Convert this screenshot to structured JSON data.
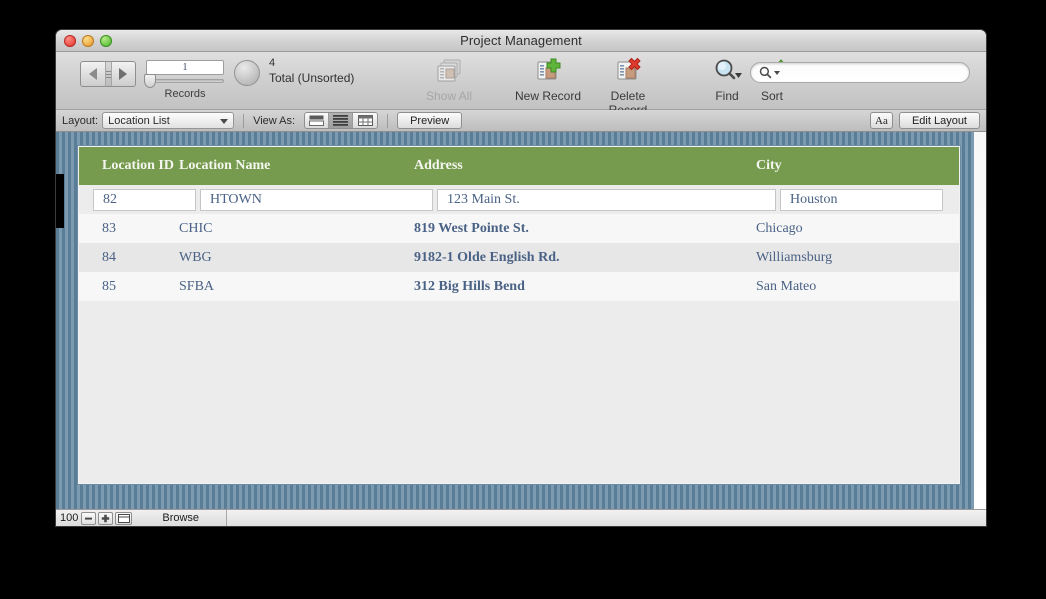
{
  "window": {
    "title": "Project Management",
    "traffic_lights": [
      "close-button",
      "minimize-button",
      "zoom-button"
    ]
  },
  "toolbar": {
    "record_number": "1",
    "records_label": "Records",
    "total_count": "4",
    "total_label": "Total (Unsorted)",
    "items": [
      {
        "name": "show-all",
        "label": "Show All",
        "icon": "records-stack-icon",
        "disabled": true
      },
      {
        "name": "new-record",
        "label": "New Record",
        "icon": "record-plus-icon",
        "disabled": false
      },
      {
        "name": "delete-record",
        "label": "Delete Record",
        "icon": "record-delete-icon",
        "disabled": false
      },
      {
        "name": "find",
        "label": "Find",
        "icon": "magnifier-icon",
        "disabled": false
      },
      {
        "name": "sort",
        "label": "Sort",
        "icon": "sort-ascending-icon",
        "disabled": false
      }
    ],
    "search": {
      "value": "",
      "placeholder": "",
      "icon": "search-icon"
    }
  },
  "layout_bar": {
    "layout_label": "Layout:",
    "layout_value": "Location List",
    "view_as_label": "View As:",
    "view_modes": [
      {
        "name": "form-view",
        "icon": "form-view-icon",
        "active": false
      },
      {
        "name": "list-view",
        "icon": "list-view-icon",
        "active": true
      },
      {
        "name": "table-view",
        "icon": "table-view-icon",
        "active": false
      }
    ],
    "preview_label": "Preview",
    "text_format_label": "Aa",
    "edit_layout_label": "Edit Layout"
  },
  "table": {
    "columns": [
      {
        "key": "id",
        "label": "Location ID"
      },
      {
        "key": "name",
        "label": "Location Name"
      },
      {
        "key": "address",
        "label": "Address"
      },
      {
        "key": "city",
        "label": "City"
      }
    ],
    "header_color": "#769b4e",
    "active_record": {
      "id": "82",
      "name": "HTOWN",
      "address": "123 Main St.",
      "city": "Houston"
    },
    "rows": [
      {
        "id": "83",
        "name": "CHIC",
        "address": "819 West Pointe St.",
        "city": "Chicago"
      },
      {
        "id": "84",
        "name": "WBG",
        "address": "9182-1 Olde English Rd.",
        "city": "Williamsburg"
      },
      {
        "id": "85",
        "name": "SFBA",
        "address": "312 Big Hills Bend",
        "city": "San Mateo"
      }
    ]
  },
  "status_bar": {
    "zoom_level": "100",
    "zoom_out_label": "−",
    "zoom_in_label": "+",
    "mode": "Browse"
  }
}
